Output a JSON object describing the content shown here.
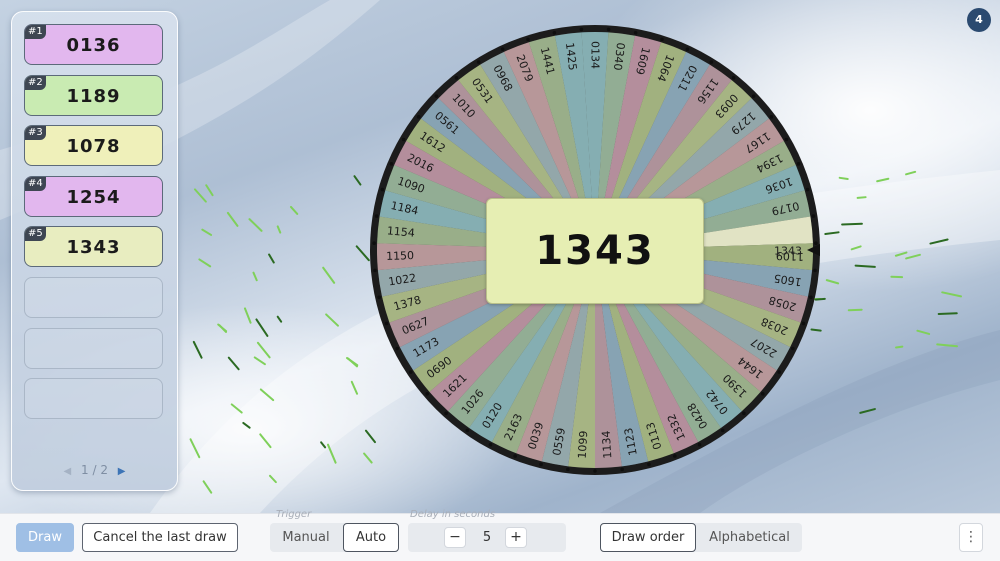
{
  "results": {
    "slots": [
      {
        "badge": "#1",
        "value": "0136",
        "color": "#e2b7ee"
      },
      {
        "badge": "#2",
        "value": "1189",
        "color": "#c9ebb2"
      },
      {
        "badge": "#3",
        "value": "1078",
        "color": "#eff0ba"
      },
      {
        "badge": "#4",
        "value": "1254",
        "color": "#e2b7ee"
      },
      {
        "badge": "#5",
        "value": "1343",
        "color": "#e8edc0"
      },
      {
        "badge": "",
        "value": "",
        "color": ""
      },
      {
        "badge": "",
        "value": "",
        "color": ""
      },
      {
        "badge": "",
        "value": "",
        "color": ""
      }
    ],
    "pager": {
      "prev_icon": "chevron-left-icon",
      "text": "1 / 2",
      "next_icon": "chevron-right-icon"
    }
  },
  "wheel": {
    "selected": "1343",
    "pointer_label": "1343",
    "entries": [
      "0134",
      "0340",
      "1609",
      "1064",
      "0211",
      "1156",
      "0093",
      "1279",
      "1167",
      "1394",
      "1036",
      "0179",
      "1343",
      "1109",
      "1605",
      "2058",
      "2038",
      "2207",
      "1644",
      "1390",
      "0742",
      "0428",
      "1332",
      "0113",
      "1123",
      "1134",
      "1099",
      "0559",
      "0039",
      "2163",
      "0120",
      "1026",
      "1621",
      "0690",
      "1173",
      "0627",
      "1378",
      "1022",
      "1150",
      "1154",
      "1184",
      "1090",
      "2016",
      "1612",
      "0561",
      "1010",
      "0531",
      "0968",
      "2079",
      "1441",
      "1425"
    ],
    "segment_colors": [
      "#68a0b4",
      "#7c9f86",
      "#b06f93",
      "#93a566",
      "#6b8fb6",
      "#a6768f",
      "#9aaa6c",
      "#7d95a8",
      "#b47d8e",
      "#86a076"
    ]
  },
  "badge_count": "4",
  "toolbar": {
    "draw_label": "Draw",
    "cancel_label": "Cancel the last draw",
    "trigger": {
      "label": "Trigger",
      "options": [
        "Manual",
        "Auto"
      ],
      "selected": "Auto"
    },
    "delay": {
      "label": "Delay in seconds",
      "minus": "−",
      "value": "5",
      "plus": "+"
    },
    "order": {
      "options": [
        "Draw order",
        "Alphabetical"
      ],
      "selected": "Draw order"
    },
    "more_icon": "more-vertical-icon"
  }
}
